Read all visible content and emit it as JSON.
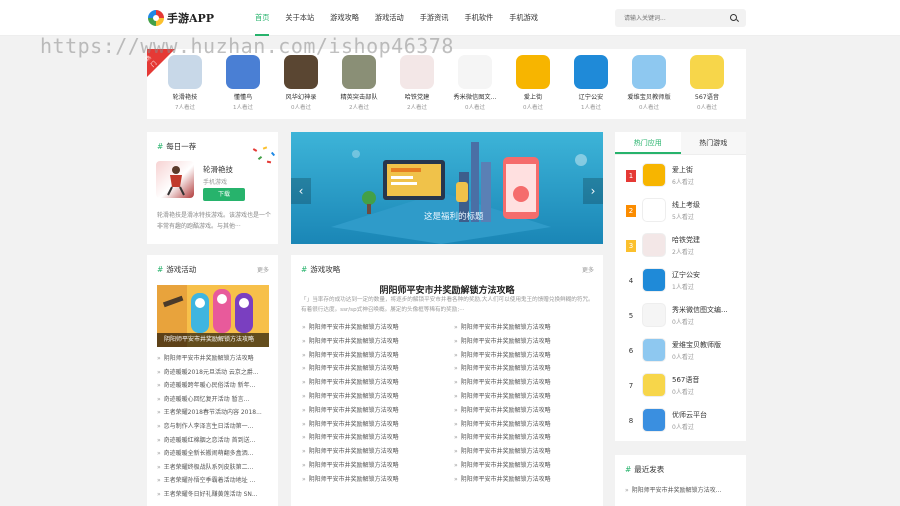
{
  "brand": {
    "logo_text": "手游APP"
  },
  "nav": [
    {
      "label": "首页",
      "active": true
    },
    {
      "label": "关于本站"
    },
    {
      "label": "游戏攻略"
    },
    {
      "label": "游戏活动"
    },
    {
      "label": "手游资讯"
    },
    {
      "label": "手机软件"
    },
    {
      "label": "手机游戏"
    }
  ],
  "search": {
    "placeholder": "请输入关键词..."
  },
  "watermark": "https://www.huzhan.com/ishop46378",
  "apps_strip": {
    "tag": "热门",
    "items": [
      {
        "name": "轮滑艳技",
        "views": "7人看过",
        "color": "#c8d8e8",
        "icon": "skater-icon"
      },
      {
        "name": "懂懂鸟",
        "views": "1人看过",
        "color": "#4a7fd4",
        "icon": "bird-icon"
      },
      {
        "name": "风华幻神录",
        "views": "0人看过",
        "color": "#5a4632",
        "icon": "fantasy-icon"
      },
      {
        "name": "精英突击部队",
        "views": "2人看过",
        "color": "#8a8f76",
        "icon": "soldier-icon"
      },
      {
        "name": "哈铁党建",
        "views": "2人看过",
        "color": "#f3e7e7",
        "icon": "party-icon"
      },
      {
        "name": "秀米微信图文...",
        "views": "0人看过",
        "color": "#f5f5f5",
        "icon": "xiumi-icon"
      },
      {
        "name": "爱上街",
        "views": "0人看过",
        "color": "#f7b500",
        "icon": "shopping-icon"
      },
      {
        "name": "辽宁公安",
        "views": "1人看过",
        "color": "#1f8ad8",
        "icon": "police-icon"
      },
      {
        "name": "爱维宝贝教师版",
        "views": "0人看过",
        "color": "#8ec8f0",
        "icon": "ai-icon"
      },
      {
        "name": "567语音",
        "views": "0人看过",
        "color": "#f7d64a",
        "icon": "voice-icon"
      }
    ]
  },
  "daily": {
    "title_prefix": "#",
    "title": "每日一荐",
    "name": "轮滑艳技",
    "category": "手机游戏",
    "download": "下载",
    "description": "轮滑艳技是滑冰特技游戏。该游戏也是一个非常有趣的跑酷游戏。与其他···"
  },
  "banner": {
    "caption": "这是福利的标题",
    "prev": "‹",
    "next": "›"
  },
  "hot_panel": {
    "tabs": [
      "热门应用",
      "热门游戏"
    ],
    "items": [
      {
        "rank": "1",
        "name": "爱上街",
        "views": "6人看过",
        "color": "#f7b500",
        "icon": "shopping-icon"
      },
      {
        "rank": "2",
        "name": "线上考级",
        "views": "5人看过",
        "color": "#ffffff",
        "icon": "exam-icon"
      },
      {
        "rank": "3",
        "name": "哈铁党建",
        "views": "2人看过",
        "color": "#f3e7e7",
        "icon": "party-icon"
      },
      {
        "rank": "4",
        "name": "辽宁公安",
        "views": "1人看过",
        "color": "#1f8ad8",
        "icon": "police-icon"
      },
      {
        "rank": "5",
        "name": "秀米微信图文编...",
        "views": "0人看过",
        "color": "#f5f5f5",
        "icon": "xiumi-icon"
      },
      {
        "rank": "6",
        "name": "爱维宝贝教师版",
        "views": "0人看过",
        "color": "#8ec8f0",
        "icon": "ai-icon"
      },
      {
        "rank": "7",
        "name": "567语音",
        "views": "0人看过",
        "color": "#f7d64a",
        "icon": "voice-icon"
      },
      {
        "rank": "8",
        "name": "优师云平台",
        "views": "0人看过",
        "color": "#3a8fe0",
        "icon": "cloud-icon"
      }
    ],
    "rank_colors": [
      "#e53935",
      "#fb8c00",
      "#fbc02d"
    ]
  },
  "activity": {
    "title": "游戏活动",
    "more": "更多",
    "image_caption": "阴阳师平安市井奖励解锁方法攻略",
    "items": [
      "阴阳师平安市井奖励解锁方法攻略",
      "奇迹暖暖2018元旦活动 云京之爵...",
      "奇迹暖暖跨年暖心民俗活动 新年...",
      "奇迹暖暖心回忆复开活动 暂言...",
      "王者荣耀2018春节活动内容 2018...",
      "恋与制作人李泽言生日活动第一...",
      "奇迹暖暖红棉胭之恋活动 首到送...",
      "奇迹暖暖全新长搬闹萌翻多盒洒...",
      "王者荣耀终极战队系列皮肤第二...",
      "王者荣耀孙悟空季霸着活动地址 ...",
      "王者荣耀冬日好礼赚黄莲活动 SN..."
    ]
  },
  "guides": {
    "title": "游戏攻略",
    "more": "更多",
    "headline": "阴阳师平安市井奖励解锁方法攻略",
    "summary": "「」当率存的成功达到一定的数量，将逐步的解锁平安市井看各种的奖励,大人们可以使用鬼王的馈赠兑换鲜糊的符咒。有着很行达度。ssr/sp式神召唤概。屡定的头像框等稀有的奖励;···",
    "items_left": [
      "阴阳师平安市井奖励解锁方法攻略",
      "阴阳师平安市井奖励解锁方法攻略",
      "阴阳师平安市井奖励解锁方法攻略",
      "阴阳师平安市井奖励解锁方法攻略",
      "阴阳师平安市井奖励解锁方法攻略",
      "阴阳师平安市井奖励解锁方法攻略",
      "阴阳师平安市井奖励解锁方法攻略",
      "阴阳师平安市井奖励解锁方法攻略",
      "阴阳师平安市井奖励解锁方法攻略",
      "阴阳师平安市井奖励解锁方法攻略",
      "阴阳师平安市井奖励解锁方法攻略",
      "阴阳师平安市井奖励解锁方法攻略"
    ],
    "items_right": [
      "阴阳师平安市井奖励解锁方法攻略",
      "阴阳师平安市井奖励解锁方法攻略",
      "阴阳师平安市井奖励解锁方法攻略",
      "阴阳师平安市井奖励解锁方法攻略",
      "阴阳师平安市井奖励解锁方法攻略",
      "阴阳师平安市井奖励解锁方法攻略",
      "阴阳师平安市井奖励解锁方法攻略",
      "阴阳师平安市井奖励解锁方法攻略",
      "阴阳师平安市井奖励解锁方法攻略",
      "阴阳师平安市井奖励解锁方法攻略",
      "阴阳师平安市井奖励解锁方法攻略",
      "阴阳师平安市井奖励解锁方法攻略"
    ]
  },
  "latest": {
    "title": "最近发表",
    "items": [
      "阴阳师平安市井奖励解锁方法攻..."
    ]
  },
  "colors": {
    "accent": "#27b36c",
    "background": "#f2f2f2",
    "hot_tag": "#e53935"
  }
}
